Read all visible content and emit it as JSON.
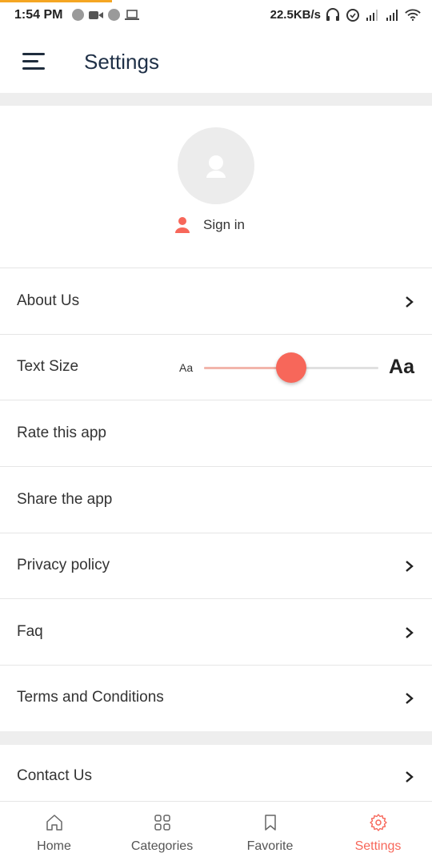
{
  "status_bar": {
    "time": "1:54 PM",
    "speed": "22.5KB/s",
    "icons": [
      "notification-dot-icon",
      "video-camera-icon",
      "notification-dot-icon",
      "laptop-icon",
      "headphones-icon",
      "alarm-icon",
      "signal-icon",
      "signal-icon",
      "wifi-icon"
    ],
    "accent_color": "#f5a623"
  },
  "header": {
    "title": "Settings",
    "menu_icon": "hamburger-menu-icon"
  },
  "profile": {
    "avatar_icon": "user-avatar-icon",
    "signin_label": "Sign in",
    "signin_icon": "user-icon"
  },
  "menu": {
    "about_us": "About Us",
    "text_size": "Text Size",
    "text_size_small": "Aa",
    "text_size_large": "Aa",
    "text_size_level": 0.5,
    "rate_app": "Rate this app",
    "share_app": "Share the app",
    "privacy_policy": "Privacy policy",
    "faq": "Faq",
    "terms": "Terms and Conditions",
    "contact_us": "Contact Us"
  },
  "bottom_nav": {
    "home": "Home",
    "categories": "Categories",
    "favorite": "Favorite",
    "settings": "Settings",
    "active": "settings"
  },
  "colors": {
    "accent": "#f7675a",
    "title": "#1f3047",
    "divider": "#eeeeee"
  }
}
